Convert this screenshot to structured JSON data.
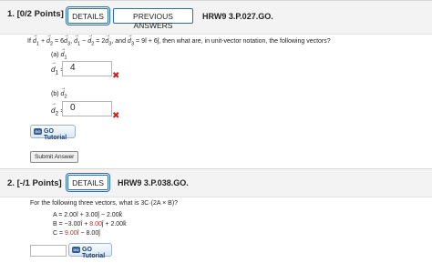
{
  "q1": {
    "number": "1.",
    "points": "[0/2 Points]",
    "details_label": "DETAILS",
    "prev_label": "PREVIOUS ANSWERS",
    "code": "HRW9 3.P.027.GO.",
    "prompt_pre": "If",
    "prompt_mid": ", and",
    "prompt_tail": "= 9î + 6ĵ, then what are, in unit-vector notation, the following vectors?",
    "part_a": "(a)",
    "part_b": "(b)",
    "answer_a": "4",
    "answer_b": "0",
    "tutorial_label": "GO Tutorial",
    "submit_label": "Submit Answer"
  },
  "q2": {
    "number": "2.",
    "points": "[-/1 Points]",
    "details_label": "DETAILS",
    "code": "HRW9 3.P.038.GO.",
    "prompt": "For the following three vectors, what is 3C·(2A × B)?",
    "vector_a": "A = 2.00î + 3.00ĵ − 2.00k̂",
    "vector_b_pre": "B = −3.00î + ",
    "vector_b_red": "8.00",
    "vector_b_post": "ĵ + 2.00k̂",
    "vector_c_pre": "C = ",
    "vector_c_red": "9.00",
    "vector_c_post": "î − 8.00ĵ",
    "tutorial_label": "GO Tutorial"
  },
  "colors": {
    "accent": "#2d6ea8",
    "error": "#d01f1f",
    "header_bg": "#f3f3f3"
  }
}
